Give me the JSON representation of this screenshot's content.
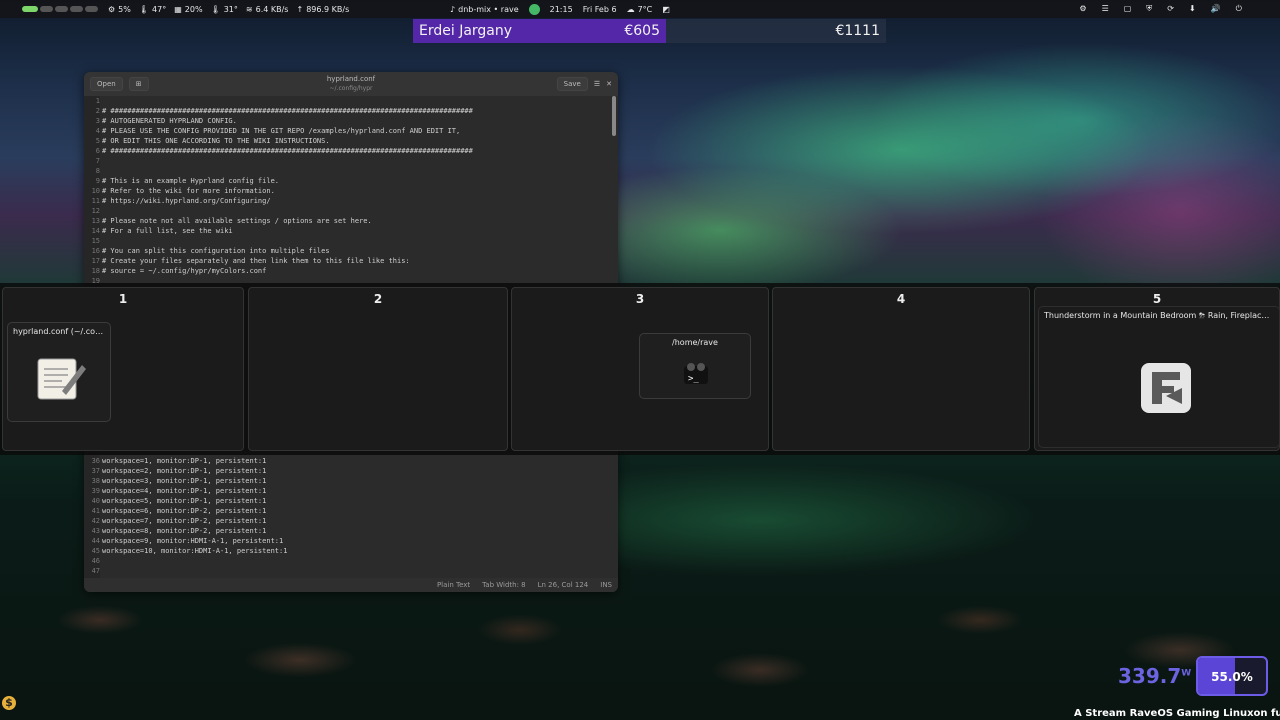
{
  "topbar": {
    "cpu": "5%",
    "gpu_temp": "47°",
    "memory": "20%",
    "cpu_temp": "31°",
    "download": "6.4 KB/s",
    "upload": "896.9 KB/s",
    "music": "dnb-mix • rave",
    "time": "21:15",
    "date": "Fri Feb 6",
    "weather": "7°C",
    "tray_icons": [
      "gear-icon",
      "sliders-icon",
      "tray-icon",
      "shield-icon",
      "updates-icon",
      "download-icon",
      "volume-icon",
      "power-icon"
    ]
  },
  "ticker": {
    "name": "Erdei Jargany",
    "amount1": "€605",
    "amount2": "€1111"
  },
  "editor": {
    "open_label": "Open",
    "title": "hyprland.conf",
    "subtitle": "~/.config/hypr",
    "save_label": "Save",
    "top_lines": [
      "",
      "# ######################################################################################",
      "# AUTOGENERATED HYPRLAND CONFIG.",
      "# PLEASE USE THE CONFIG PROVIDED IN THE GIT REPO /examples/hyprland.conf AND EDIT IT,",
      "# OR EDIT THIS ONE ACCORDING TO THE WIKI INSTRUCTIONS.",
      "# ######################################################################################",
      "",
      "",
      "# This is an example Hyprland config file.",
      "# Refer to the wiki for more information.",
      "# https://wiki.hyprland.org/Configuring/",
      "",
      "# Please note not all available settings / options are set here.",
      "# For a full list, see the wiki",
      "",
      "# You can split this configuration into multiple files",
      "# Create your files separately and then link them to this file like this:",
      "# source = ~/.config/hypr/myColors.conf",
      ""
    ],
    "bottom_line_numbers": [
      "36",
      "37",
      "38",
      "39",
      "40",
      "41",
      "42",
      "43",
      "44",
      "45",
      "46",
      "47"
    ],
    "bottom_lines": [
      "workspace=1, monitor:DP-1, persistent:1",
      "workspace=2, monitor:DP-1, persistent:1",
      "workspace=3, monitor:DP-1, persistent:1",
      "workspace=4, monitor:DP-1, persistent:1",
      "workspace=5, monitor:DP-1, persistent:1",
      "workspace=6, monitor:DP-2, persistent:1",
      "workspace=7, monitor:DP-2, persistent:1",
      "workspace=8, monitor:DP-2, persistent:1",
      "workspace=9, monitor:HDMI-A-1, persistent:1",
      "workspace=10, monitor:HDMI-A-1, persistent:1",
      "",
      ""
    ],
    "status": {
      "language": "Plain Text",
      "tab_width": "Tab Width: 8",
      "cursor": "Ln 26, Col 124",
      "mode": "INS"
    }
  },
  "overview": {
    "workspaces": [
      "1",
      "2",
      "3",
      "4",
      "5"
    ],
    "windows": {
      "editor": "hyprland.conf (~/.confi...",
      "terminal": "/home/rave",
      "browser": "Thunderstorm in a Mountain Bedroom ⛈ Rain, Fireplace & Sle..."
    }
  },
  "widgets": {
    "power": "339.7",
    "power_unit": "W",
    "battery": "55.0%",
    "battery_level": 0.55,
    "marquee": "A Stream RaveOS Gaming Linuxon fut"
  }
}
